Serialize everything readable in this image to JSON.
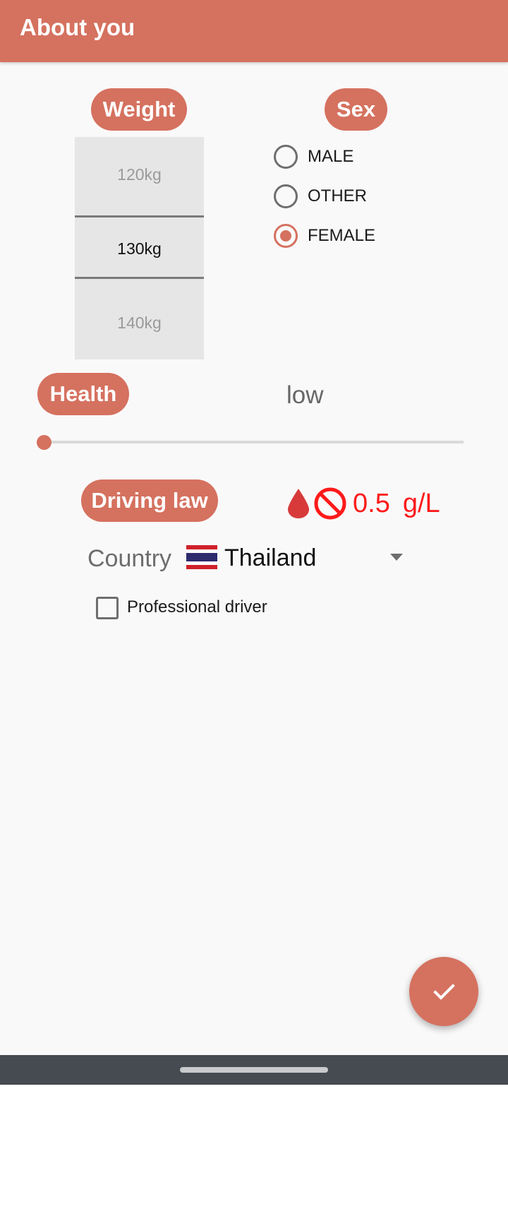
{
  "appbar": {
    "title": "About you"
  },
  "weight": {
    "label": "Weight",
    "options": [
      "120kg",
      "130kg",
      "140kg"
    ],
    "selected": "130kg"
  },
  "sex": {
    "label": "Sex",
    "options": [
      {
        "label": "MALE",
        "checked": false
      },
      {
        "label": "OTHER",
        "checked": false
      },
      {
        "label": "FEMALE",
        "checked": true
      }
    ]
  },
  "health": {
    "label": "Health",
    "value": "low",
    "slider_fraction": 0.0
  },
  "driving_law": {
    "label": "Driving law",
    "limit_value": "0.5",
    "limit_unit": "g/L",
    "icons": [
      "blood-drop-icon",
      "prohibited-icon"
    ]
  },
  "country": {
    "label": "Country",
    "selected": "Thailand",
    "flag": "thailand-flag"
  },
  "professional_driver": {
    "label": "Professional driver",
    "checked": false
  },
  "fab": {
    "icon": "check-icon"
  },
  "colors": {
    "accent": "#d5715f",
    "law_red": "#ff1a1a",
    "navbar": "#454b50"
  }
}
